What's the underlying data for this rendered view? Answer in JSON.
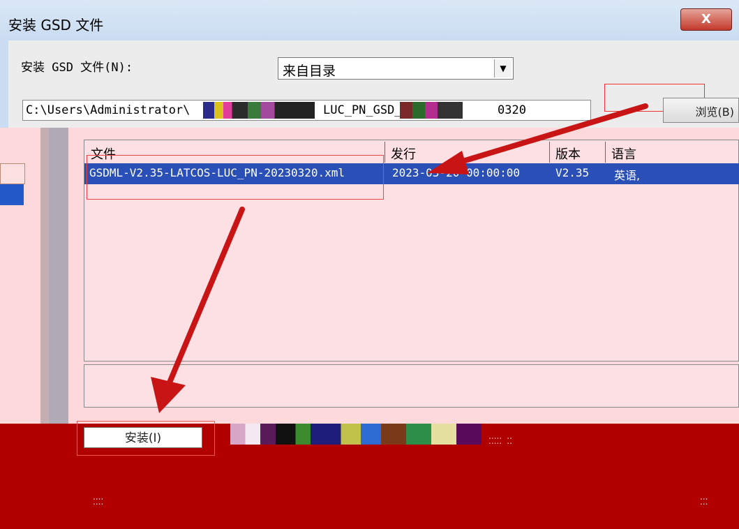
{
  "window": {
    "title": "安装 GSD 文件",
    "close_label": "X"
  },
  "install_label": "安装 GSD 文件(N):",
  "source_select": {
    "value": "来自目录"
  },
  "path_field": {
    "prefix": "C:\\Users\\Administrator\\",
    "middle": "LUC_PN_GSD_pic",
    "suffix": "0320"
  },
  "browse_button": "浏览(B)",
  "file_table": {
    "headers": [
      "文件",
      "发行",
      "版本",
      "语言"
    ],
    "rows": [
      {
        "file": "GSDML-V2.35-LATCOS-LUC_PN-20230320.xml",
        "release": "2023-03-20 00:00:00",
        "version": "V2.35",
        "language": "英语,"
      }
    ]
  },
  "install_button": "安装(I)",
  "colors": {
    "pink_overlay": "#fdd9dc",
    "selection": "#2a50b8",
    "annotation_red": "#d61f1f",
    "bottom_red": "#b10000"
  }
}
